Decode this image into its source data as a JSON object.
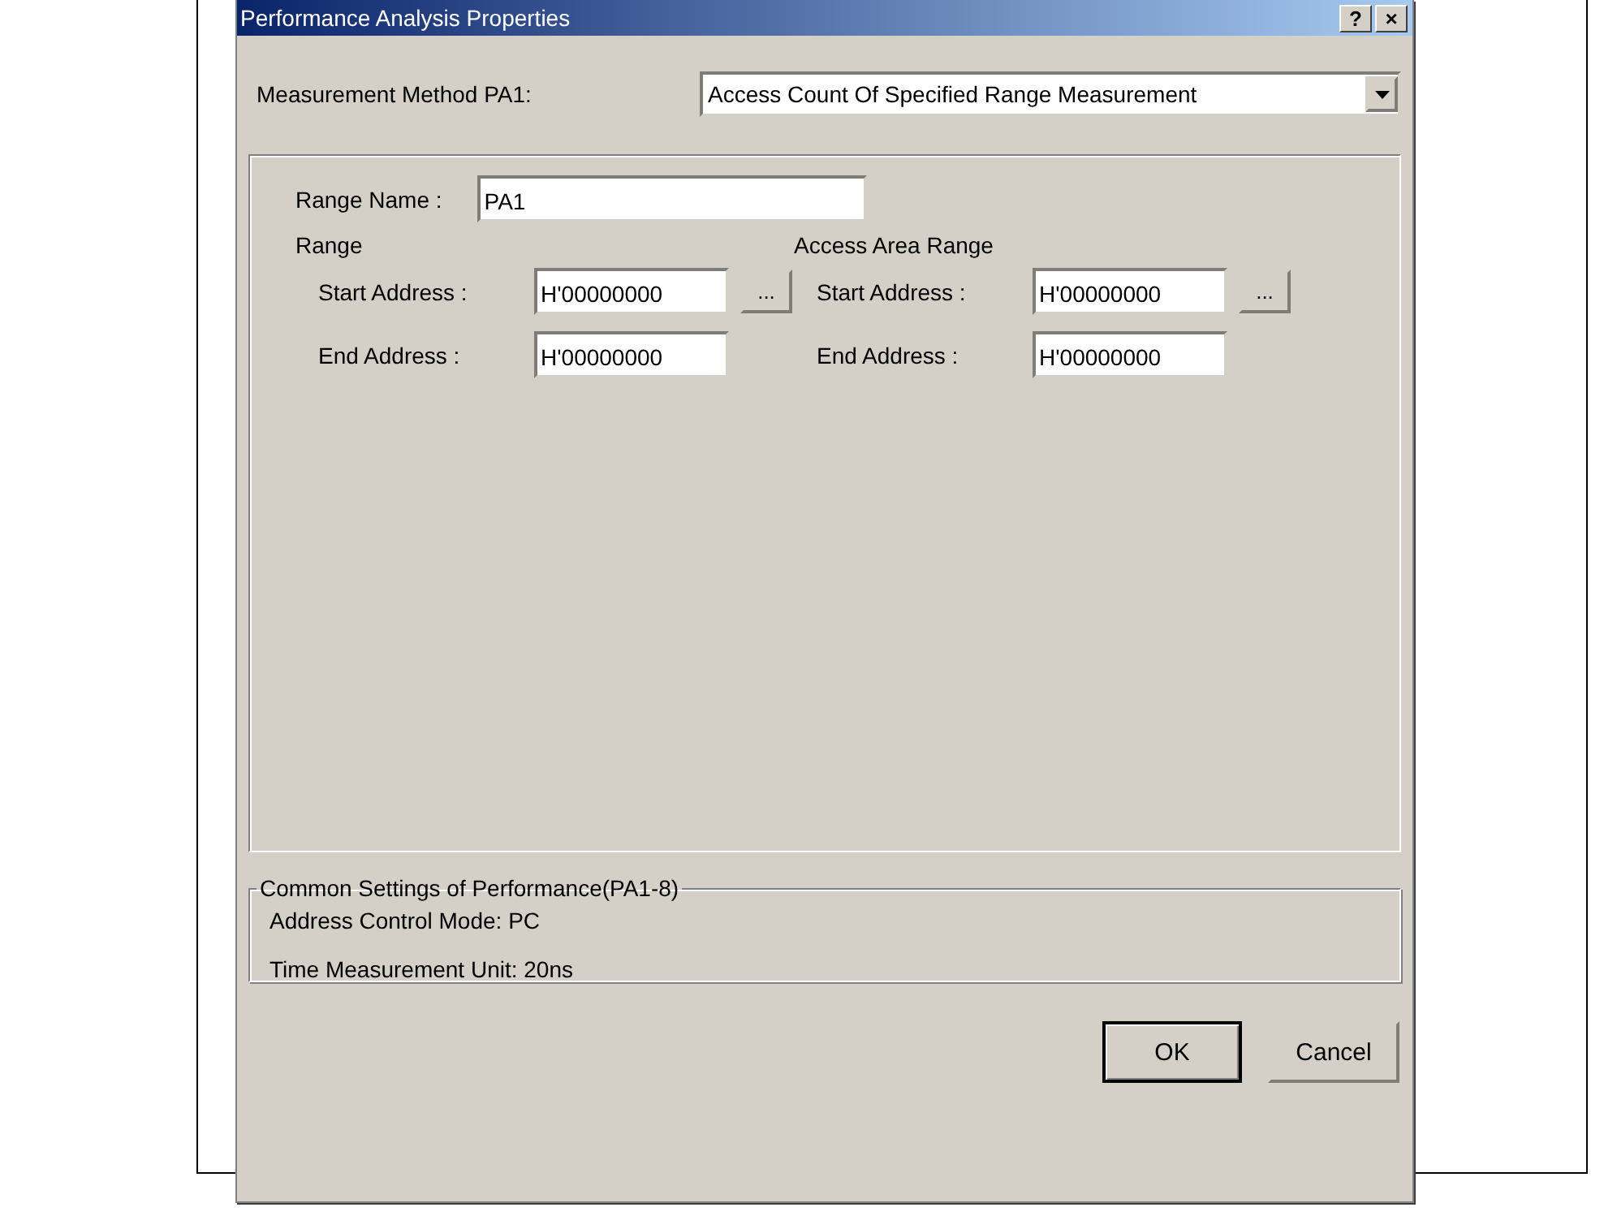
{
  "window": {
    "title": "Performance Analysis Properties",
    "title_buttons": [
      "?",
      "×"
    ]
  },
  "method": {
    "label": "Measurement Method PA1:",
    "value": "Access Count Of Specified Range Measurement"
  },
  "range_name": {
    "label": "Range Name :",
    "value": "PA1"
  },
  "ranges": [
    {
      "heading": "Range",
      "start_label": "Start Address :",
      "start_value": "H'00000000",
      "browse": "...",
      "end_label": "End Address :",
      "end_value": "H'00000000"
    },
    {
      "heading": "Access Area Range",
      "start_label": "Start Address :",
      "start_value": "H'00000000",
      "browse": "...",
      "end_label": "End Address :",
      "end_value": "H'00000000"
    }
  ],
  "common": {
    "legend": "Common Settings of Performance(PA1-8)",
    "lines": [
      "Address Control Mode: PC",
      "Time Measurement Unit: 20ns"
    ]
  },
  "buttons": [
    {
      "label": "OK",
      "default": true
    },
    {
      "label": "Cancel",
      "default": false
    }
  ]
}
